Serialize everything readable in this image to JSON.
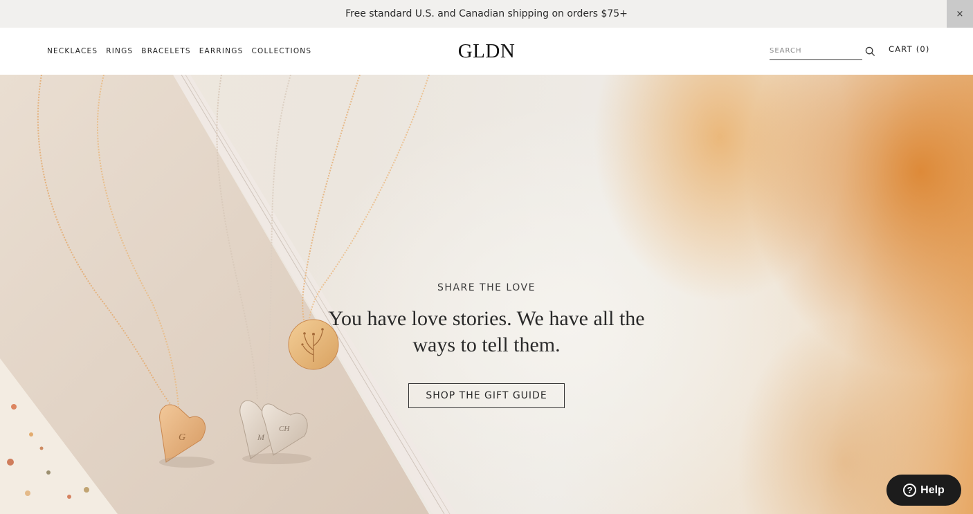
{
  "announcement": {
    "text": "Free standard U.S. and Canadian shipping on orders $75+",
    "close_label": "×"
  },
  "header": {
    "nav": [
      {
        "label": "NECKLACES"
      },
      {
        "label": "RINGS"
      },
      {
        "label": "BRACELETS"
      },
      {
        "label": "EARRINGS"
      },
      {
        "label": "COLLECTIONS"
      }
    ],
    "logo": "GLDN",
    "search_placeholder": "SEARCH",
    "cart_label": "CART (0)"
  },
  "hero": {
    "eyebrow": "SHARE THE LOVE",
    "headline": "You have love stories. We have all the ways to tell them.",
    "cta_label": "SHOP THE GIFT GUIDE",
    "pendant_initials": [
      "G",
      "M",
      "CH"
    ]
  },
  "help": {
    "label": "Help",
    "icon_glyph": "?"
  }
}
